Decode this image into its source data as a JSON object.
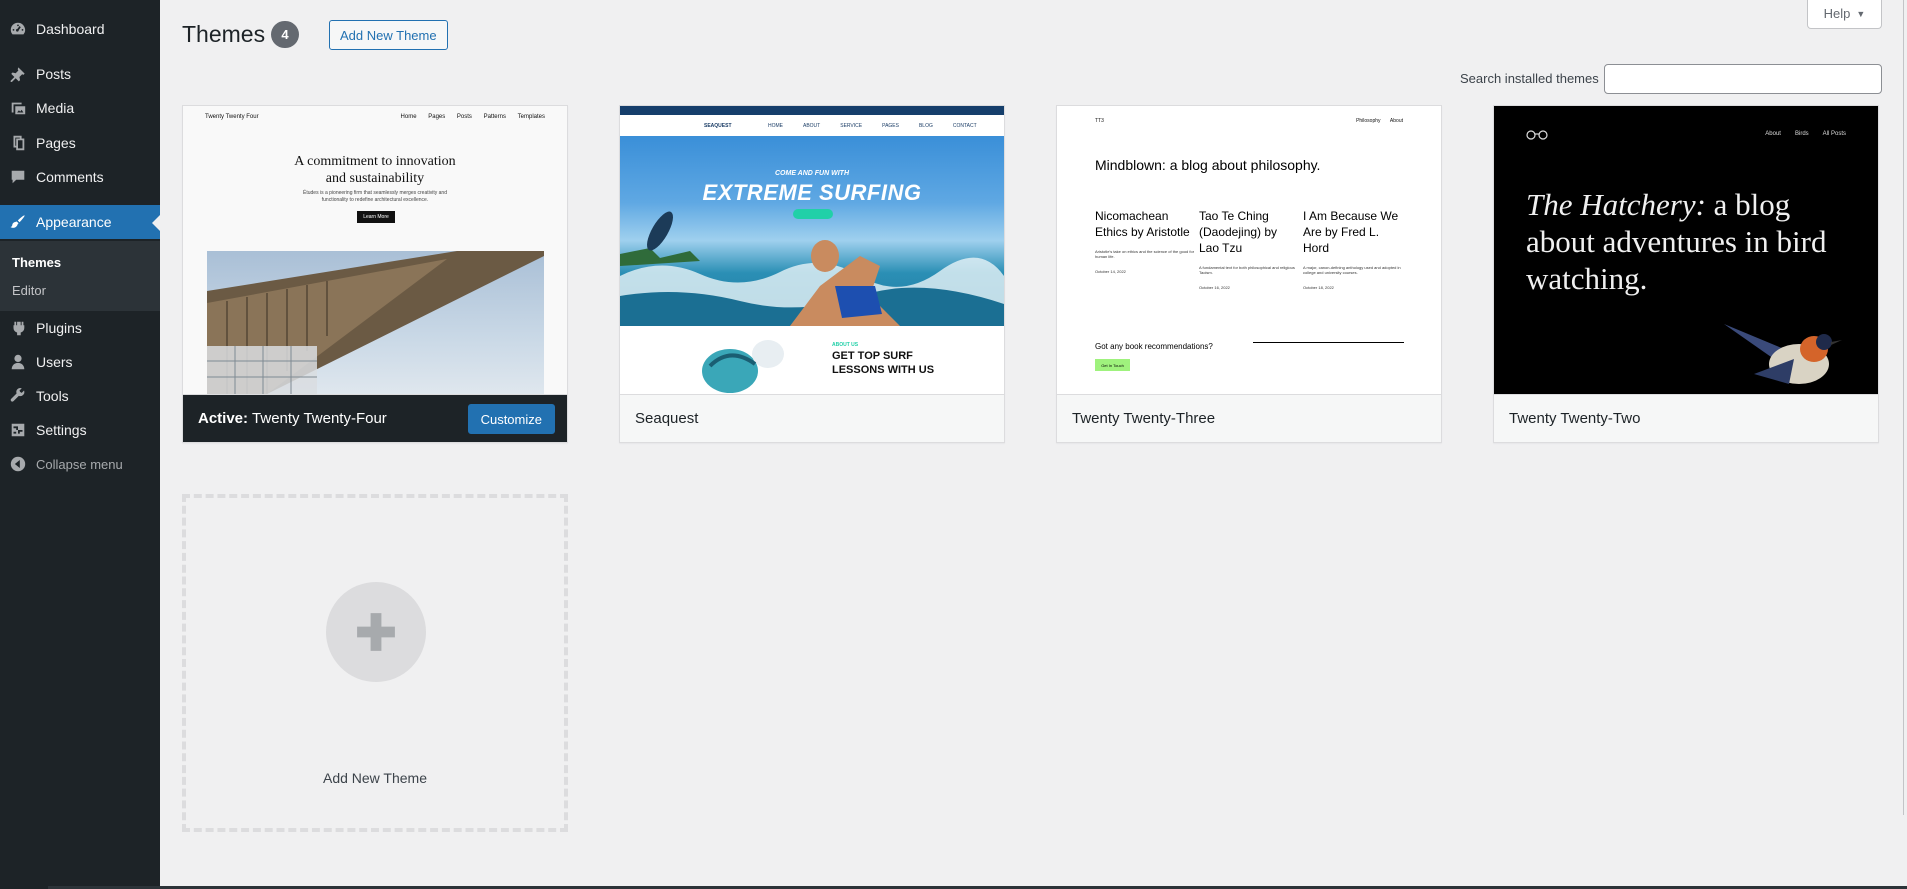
{
  "sidebar": {
    "items": [
      {
        "label": "Dashboard",
        "icon": "dashboard-icon"
      },
      {
        "label": "Posts",
        "icon": "pin-icon"
      },
      {
        "label": "Media",
        "icon": "media-icon"
      },
      {
        "label": "Pages",
        "icon": "pages-icon"
      },
      {
        "label": "Comments",
        "icon": "comment-icon"
      },
      {
        "label": "Appearance",
        "icon": "paintbrush-icon"
      },
      {
        "label": "Plugins",
        "icon": "plugin-icon"
      },
      {
        "label": "Users",
        "icon": "user-icon"
      },
      {
        "label": "Tools",
        "icon": "wrench-icon"
      },
      {
        "label": "Settings",
        "icon": "settings-icon"
      }
    ],
    "submenu": [
      {
        "label": "Themes"
      },
      {
        "label": "Editor"
      }
    ],
    "collapse_label": "Collapse menu"
  },
  "header": {
    "title": "Themes",
    "count": "4",
    "add_new_label": "Add New Theme",
    "help_label": "Help"
  },
  "search": {
    "label": "Search installed themes",
    "value": "",
    "placeholder": ""
  },
  "themes": [
    {
      "name": "Twenty Twenty-Four",
      "active_prefix": "Active:",
      "customize_label": "Customize",
      "preview": {
        "site_title": "Twenty Twenty Four",
        "nav": [
          "Home",
          "Pages",
          "Posts",
          "Patterns",
          "Templates"
        ],
        "heading_line1": "A commitment to innovation",
        "heading_line2": "and sustainability",
        "text": "Études is a pioneering firm that seamlessly merges creativity and functionality to redefine architectural excellence.",
        "button": "Learn More"
      }
    },
    {
      "name": "Seaquest",
      "preview": {
        "tagline": "COME AND FUN WITH",
        "headline": "EXTREME SURFING",
        "logo": "SEAQUEST",
        "nav": [
          "HOME",
          "ABOUT",
          "SERVICE",
          "PAGES",
          "BLOG",
          "CONTACT"
        ],
        "sub_tag": "ABOUT US",
        "sub_headline_1": "GET TOP SURF",
        "sub_headline_2": "LESSONS WITH US"
      }
    },
    {
      "name": "Twenty Twenty-Three",
      "preview": {
        "site_title": "TT3",
        "nav": [
          "Philosophy",
          "About"
        ],
        "heading": "Mindblown: a blog about philosophy.",
        "posts": [
          {
            "title": "Nicomachean Ethics by Aristotle",
            "desc": "Aristotle's take on ethics and the science of the good for human life.",
            "date": "October 14, 2022"
          },
          {
            "title": "Tao Te Ching (Daodejing) by Lao Tzu",
            "desc": "A fundamental text for both philosophical and religious Taoism.",
            "date": "October 16, 2022"
          },
          {
            "title": "I Am Because We Are by Fred L. Hord",
            "desc": "A major, canon-defining anthology used and adopted in college and university courses.",
            "date": "October 18, 2022"
          }
        ],
        "question": "Got any book recommendations?",
        "button": "Get In Touch"
      }
    },
    {
      "name": "Twenty Twenty-Two",
      "preview": {
        "nav": [
          "About",
          "Birds",
          "All Posts"
        ],
        "heading_italic": "The Hatchery:",
        "heading_rest": " a blog about adventures in bird watching."
      }
    }
  ],
  "add_new_card": {
    "label": "Add New Theme"
  },
  "colors": {
    "sidebar_bg": "#1d2327",
    "accent": "#2271b1",
    "page_bg": "#f0f0f1"
  }
}
